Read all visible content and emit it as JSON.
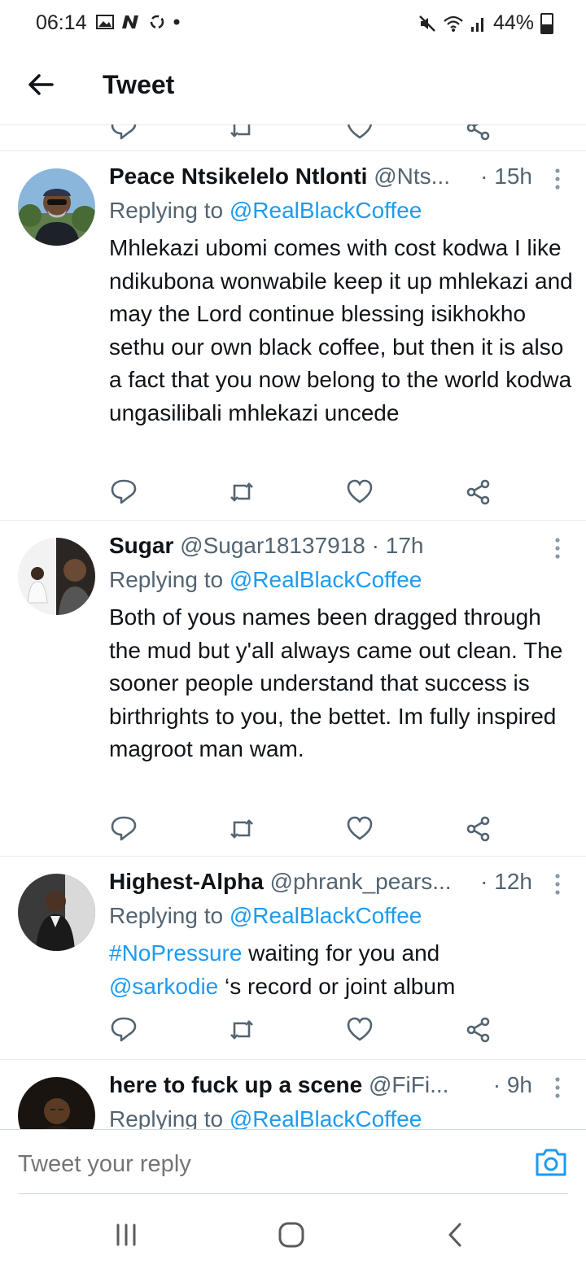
{
  "status_bar": {
    "time": "06:14",
    "left_icons": [
      "gallery-icon",
      "n-icon",
      "sync-icon",
      "dot-icon"
    ],
    "right_icons": [
      "mute-icon",
      "wifi-icon",
      "signal-icon"
    ],
    "battery": "44%"
  },
  "header": {
    "title": "Tweet"
  },
  "tweets": [
    {
      "name": "Peace Ntsikelelo Ntlonti",
      "handle": "@Nts...",
      "time": "· 15h",
      "replying_to_label": "Replying to",
      "replying_to_handle": "@RealBlackCoffee",
      "body": "Mhlekazi ubomi comes with cost kodwa I like ndikubona wonwabile keep it up mhlekazi and may the Lord continue blessing isikhokho sethu our own black coffee, but then it is also a fact that you now belong to the world kodwa ungasilibali mhlekazi uncede"
    },
    {
      "name": "Sugar",
      "handle": "@Sugar18137918",
      "time": "· 17h",
      "replying_to_label": "Replying to",
      "replying_to_handle": "@RealBlackCoffee",
      "body": "Both of yous names been dragged through the mud but y'all always came out clean. The sooner people understand that success is birthrights to you, the bettet. Im fully inspired magroot man wam."
    },
    {
      "name": "Highest-Alpha",
      "handle": "@phrank_pears...",
      "time": "· 12h",
      "replying_to_label": "Replying to",
      "replying_to_handle": "@RealBlackCoffee",
      "body_hashtag": "#NoPressure",
      "body_part1": " waiting for you and",
      "body_mention": "@sarkodie",
      "body_part2": " ‘s record or joint album"
    },
    {
      "name": "here to fuck up a scene",
      "handle": "@FiFi...",
      "time": "· 9h",
      "replying_to_label": "Replying to",
      "replying_to_handle": "@RealBlackCoffee"
    }
  ],
  "reply_bar": {
    "placeholder": "Tweet your reply"
  },
  "colors": {
    "accent": "#1d9bf0",
    "text": "#0f1419",
    "secondary": "#536471"
  }
}
